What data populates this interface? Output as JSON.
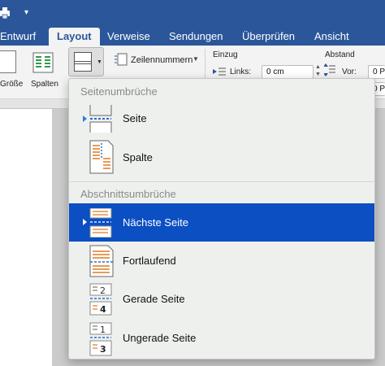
{
  "tabs": [
    {
      "label": "Entwurf"
    },
    {
      "label": "Layout",
      "active": true
    },
    {
      "label": "Verweise"
    },
    {
      "label": "Sendungen"
    },
    {
      "label": "Überprüfen"
    },
    {
      "label": "Ansicht"
    }
  ],
  "ribbon": {
    "groesse_label": "Größe",
    "spalten_label": "Spalten",
    "zeilennummern_label": "Zeilennummern",
    "einzug_label": "Einzug",
    "links_label": "Links:",
    "links_value": "0 cm",
    "abstand_label": "Abstand",
    "vor_label": "Vor:",
    "vor_value": "0 P",
    "nach_value": "0 P"
  },
  "menu": {
    "section1_title": "Seitenumbrüche",
    "section2_title": "Abschnittsumbrüche",
    "items": [
      {
        "label": "Seite",
        "icon": "page-break-icon"
      },
      {
        "label": "Spalte",
        "icon": "column-break-icon"
      },
      {
        "label": "Nächste Seite",
        "icon": "next-page-break-icon",
        "selected": true
      },
      {
        "label": "Fortlaufend",
        "icon": "continuous-break-icon"
      },
      {
        "label": "Gerade Seite",
        "icon": "even-page-break-icon",
        "num_top": "2",
        "num_bottom": "4"
      },
      {
        "label": "Ungerade Seite",
        "icon": "odd-page-break-icon",
        "num_top": "1",
        "num_bottom": "3"
      }
    ]
  },
  "colors": {
    "ribbon_blue": "#2b579a",
    "selection": "#0c4fc3",
    "accent_orange": "#e07a1f",
    "marker_blue": "#2e7dd7"
  }
}
